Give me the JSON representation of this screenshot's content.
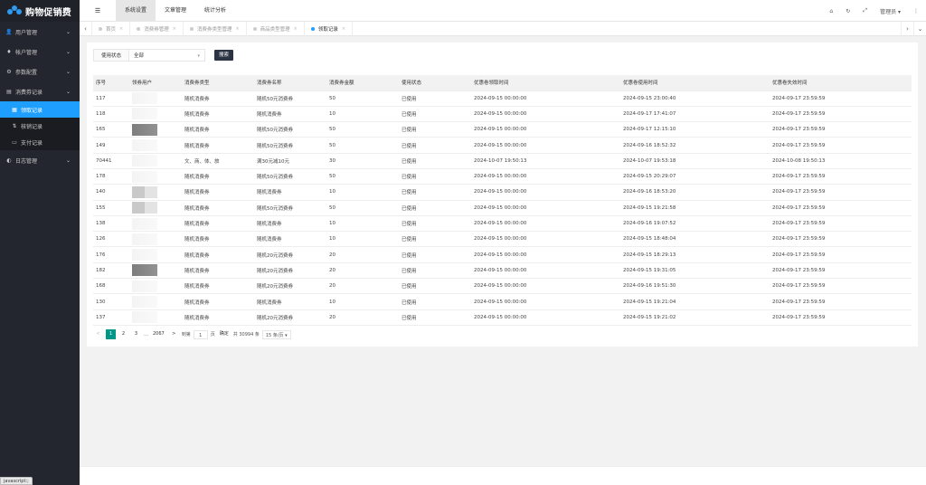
{
  "app": {
    "title": "购物促销费"
  },
  "sidebar": {
    "items": [
      {
        "icon": "user-icon",
        "glyph": "👤",
        "label": "用户管理"
      },
      {
        "icon": "account-icon",
        "glyph": "♦",
        "label": "帐户管理"
      },
      {
        "icon": "settings-icon",
        "glyph": "⚙",
        "label": "参数配置"
      },
      {
        "icon": "coupon-record-icon",
        "glyph": "▤",
        "label": "消费券记录"
      }
    ],
    "sub_items": [
      {
        "icon": "list-icon",
        "glyph": "▦",
        "label": "领取记录",
        "active": true
      },
      {
        "icon": "swap-icon",
        "glyph": "⇅",
        "label": "核销记录",
        "active": false
      },
      {
        "icon": "payment-icon",
        "glyph": "▭",
        "label": "支付记录",
        "active": false
      }
    ],
    "log_item": {
      "icon": "log-icon",
      "glyph": "◐",
      "label": "日志管理"
    }
  },
  "status_tip": "javascript:;",
  "header": {
    "menu": [
      {
        "label": "系统设置",
        "active": true
      },
      {
        "label": "文章管理",
        "active": false
      },
      {
        "label": "统计分析",
        "active": false
      }
    ],
    "admin_label": "管理员"
  },
  "tabs": [
    {
      "label": "首页",
      "active": false
    },
    {
      "label": "消费券管理",
      "active": false
    },
    {
      "label": "消费券类型管理",
      "active": false
    },
    {
      "label": "商品类型管理",
      "active": false
    },
    {
      "label": "领取记录",
      "active": true
    }
  ],
  "filter": {
    "label": "使用状态",
    "selected": "全部",
    "search_button": "搜索"
  },
  "table": {
    "columns": [
      "序号",
      "领券用户",
      "消费券类型",
      "消费券名称",
      "消费券金额",
      "使用状态",
      "优惠卷领取时间",
      "优惠卷使用时间",
      "优惠卷失效时间"
    ],
    "rows": [
      {
        "id": "117",
        "type": "随机消费券",
        "name": "随机50元消费券",
        "amount": "50",
        "status": "已使用",
        "received": "2024-09-15 00:00:00",
        "used": "2024-09-15 23:00:40",
        "expire": "2024-09-17 23:59:59",
        "blur": "light"
      },
      {
        "id": "118",
        "type": "随机消费券",
        "name": "随机消费券",
        "amount": "10",
        "status": "已使用",
        "received": "2024-09-15 00:00:00",
        "used": "2024-09-17 17:41:07",
        "expire": "2024-09-17 23:59:59",
        "blur": "light"
      },
      {
        "id": "165",
        "type": "随机消费券",
        "name": "随机50元消费券",
        "amount": "50",
        "status": "已使用",
        "received": "2024-09-15 00:00:00",
        "used": "2024-09-17 12:15:10",
        "expire": "2024-09-17 23:59:59",
        "blur": "dark"
      },
      {
        "id": "149",
        "type": "随机消费券",
        "name": "随机50元消费券",
        "amount": "50",
        "status": "已使用",
        "received": "2024-09-15 00:00:00",
        "used": "2024-09-16 18:52:32",
        "expire": "2024-09-17 23:59:59",
        "blur": "light"
      },
      {
        "id": "70441",
        "type": "文、商、体、旅",
        "name": "满30元减10元",
        "amount": "30",
        "status": "已使用",
        "received": "2024-10-07 19:50:13",
        "used": "2024-10-07 19:53:18",
        "expire": "2024-10-08 19:50:13",
        "blur": "light"
      },
      {
        "id": "178",
        "type": "随机消费券",
        "name": "随机50元消费券",
        "amount": "50",
        "status": "已使用",
        "received": "2024-09-15 00:00:00",
        "used": "2024-09-15 20:29:07",
        "expire": "2024-09-17 23:59:59",
        "blur": "light"
      },
      {
        "id": "140",
        "type": "随机消费券",
        "name": "随机消费券",
        "amount": "10",
        "status": "已使用",
        "received": "2024-09-15 00:00:00",
        "used": "2024-09-16 18:53:20",
        "expire": "2024-09-17 23:59:59",
        "blur": "mid"
      },
      {
        "id": "155",
        "type": "随机消费券",
        "name": "随机50元消费券",
        "amount": "50",
        "status": "已使用",
        "received": "2024-09-15 00:00:00",
        "used": "2024-09-15 19:21:58",
        "expire": "2024-09-17 23:59:59",
        "blur": "mid"
      },
      {
        "id": "138",
        "type": "随机消费券",
        "name": "随机消费券",
        "amount": "10",
        "status": "已使用",
        "received": "2024-09-15 00:00:00",
        "used": "2024-09-16 19:07:52",
        "expire": "2024-09-17 23:59:59",
        "blur": "light"
      },
      {
        "id": "126",
        "type": "随机消费券",
        "name": "随机消费券",
        "amount": "10",
        "status": "已使用",
        "received": "2024-09-15 00:00:00",
        "used": "2024-09-15 18:48:04",
        "expire": "2024-09-17 23:59:59",
        "blur": "light"
      },
      {
        "id": "176",
        "type": "随机消费券",
        "name": "随机20元消费券",
        "amount": "20",
        "status": "已使用",
        "received": "2024-09-15 00:00:00",
        "used": "2024-09-15 18:29:13",
        "expire": "2024-09-17 23:59:59",
        "blur": "light"
      },
      {
        "id": "182",
        "type": "随机消费券",
        "name": "随机20元消费券",
        "amount": "20",
        "status": "已使用",
        "received": "2024-09-15 00:00:00",
        "used": "2024-09-15 19:31:05",
        "expire": "2024-09-17 23:59:59",
        "blur": "dark"
      },
      {
        "id": "168",
        "type": "随机消费券",
        "name": "随机20元消费券",
        "amount": "20",
        "status": "已使用",
        "received": "2024-09-15 00:00:00",
        "used": "2024-09-16 19:51:30",
        "expire": "2024-09-17 23:59:59",
        "blur": "light"
      },
      {
        "id": "130",
        "type": "随机消费券",
        "name": "随机消费券",
        "amount": "10",
        "status": "已使用",
        "received": "2024-09-15 00:00:00",
        "used": "2024-09-15 19:21:04",
        "expire": "2024-09-17 23:59:59",
        "blur": "light"
      },
      {
        "id": "137",
        "type": "随机消费券",
        "name": "随机20元消费券",
        "amount": "20",
        "status": "已使用",
        "received": "2024-09-15 00:00:00",
        "used": "2024-09-15 19:21:02",
        "expire": "2024-09-17 23:59:59",
        "blur": "light"
      }
    ]
  },
  "pager": {
    "prev": "<",
    "pages": [
      "1",
      "2",
      "3"
    ],
    "ellipsis": "…",
    "last": "2067",
    "next": ">",
    "goto_label": "到第",
    "goto_value": "1",
    "page_unit": "页",
    "confirm": "确定",
    "total": "共 30994 条",
    "page_size": "15 条/页"
  },
  "colors": {
    "sidebar_bg": "#23262e",
    "active_blue": "#1e9fff",
    "pager_active": "#009688"
  }
}
